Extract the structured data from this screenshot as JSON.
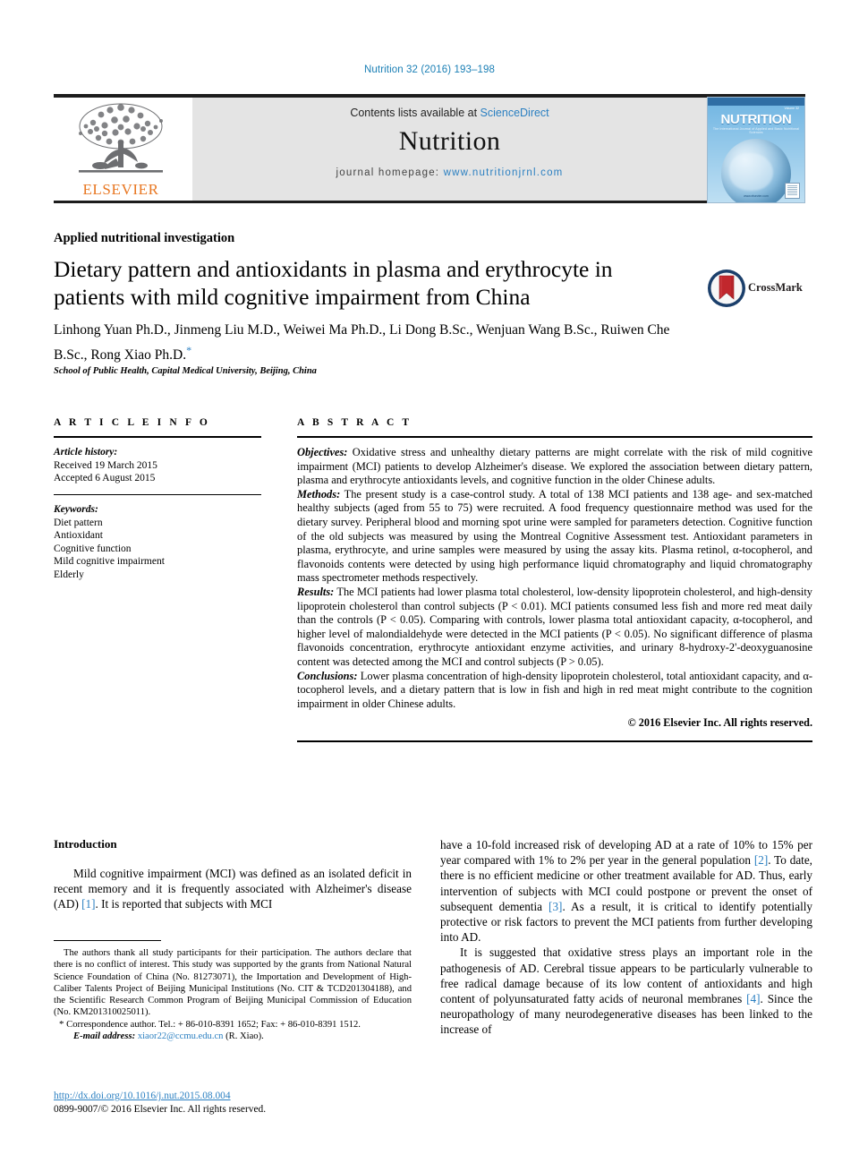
{
  "running_head": "Nutrition 32 (2016) 193–198",
  "masthead": {
    "contents_prefix": "Contents lists available at",
    "contents_link": "ScienceDirect",
    "journal_name": "Nutrition",
    "homepage_prefix": "journal homepage:",
    "homepage_url": "www.nutritionjrnl.com",
    "publisher_name": "ELSEVIER",
    "cover": {
      "title": "NUTRITION",
      "volume": "Volume 32",
      "subtitle": "The International Journal of Applied and Basic Nutritional Sciences",
      "footer": "www.elsevier.com"
    }
  },
  "article": {
    "section_label": "Applied nutritional investigation",
    "title": "Dietary pattern and antioxidants in plasma and erythrocyte in patients with mild cognitive impairment from China",
    "authors": "Linhong Yuan Ph.D., Jinmeng Liu M.D., Weiwei Ma Ph.D., Li Dong B.Sc., Wenjuan Wang B.Sc., Ruiwen Che B.Sc., Rong Xiao Ph.D.",
    "corresponding_marker": "*",
    "affiliation": "School of Public Health, Capital Medical University, Beijing, China",
    "crossmark_label": "CrossMark"
  },
  "article_info": {
    "heading": "A R T I C L E   I N F O",
    "history_label": "Article history:",
    "received": "Received 19 March 2015",
    "accepted": "Accepted 6 August 2015",
    "keywords_label": "Keywords:",
    "keywords": [
      "Diet pattern",
      "Antioxidant",
      "Cognitive function",
      "Mild cognitive impairment",
      "Elderly"
    ]
  },
  "abstract": {
    "heading": "A B S T R A C T",
    "sections": [
      {
        "lead": "Objectives:",
        "text": " Oxidative stress and unhealthy dietary patterns are might correlate with the risk of mild cognitive impairment (MCI) patients to develop Alzheimer's disease. We explored the association between dietary pattern, plasma and erythrocyte antioxidants levels, and cognitive function in the older Chinese adults."
      },
      {
        "lead": "Methods:",
        "text": " The present study is a case-control study. A total of 138 MCI patients and 138 age- and sex-matched healthy subjects (aged from 55 to 75) were recruited. A food frequency questionnaire method was used for the dietary survey. Peripheral blood and morning spot urine were sampled for parameters detection. Cognitive function of the old subjects was measured by using the Montreal Cognitive Assessment test. Antioxidant parameters in plasma, erythrocyte, and urine samples were measured by using the assay kits. Plasma retinol, α-tocopherol, and flavonoids contents were detected by using high performance liquid chromatography and liquid chromatography mass spectrometer methods respectively."
      },
      {
        "lead": "Results:",
        "text": " The MCI patients had lower plasma total cholesterol, low-density lipoprotein cholesterol, and high-density lipoprotein cholesterol than control subjects (P < 0.01). MCI patients consumed less fish and more red meat daily than the controls (P < 0.05). Comparing with controls, lower plasma total antioxidant capacity, α-tocopherol, and higher level of malondialdehyde were detected in the MCI patients (P < 0.05). No significant difference of plasma flavonoids concentration, erythrocyte antioxidant enzyme activities, and urinary 8-hydroxy-2'-deoxyguanosine content was detected among the MCI and control subjects (P > 0.05)."
      },
      {
        "lead": "Conclusions:",
        "text": " Lower plasma concentration of high-density lipoprotein cholesterol, total antioxidant capacity, and α-tocopherol levels, and a dietary pattern that is low in fish and high in red meat might contribute to the cognition impairment in older Chinese adults."
      }
    ],
    "copyright": "© 2016 Elsevier Inc. All rights reserved."
  },
  "body": {
    "intro_heading": "Introduction",
    "left_paragraph_1_a": "Mild cognitive impairment (MCI) was defined as an isolated deficit in recent memory and it is frequently associated with Alzheimer's disease (AD) ",
    "left_paragraph_1_ref": "[1]",
    "left_paragraph_1_b": ". It is reported that subjects with MCI",
    "right_paragraph_1_a": "have a 10-fold increased risk of developing AD at a rate of 10% to 15% per year compared with 1% to 2% per year in the general population ",
    "right_paragraph_1_ref1": "[2]",
    "right_paragraph_1_b": ". To date, there is no efficient medicine or other treatment available for AD. Thus, early intervention of subjects with MCI could postpone or prevent the onset of subsequent dementia ",
    "right_paragraph_1_ref2": "[3]",
    "right_paragraph_1_c": ". As a result, it is critical to identify potentially protective or risk factors to prevent the MCI patients from further developing into AD.",
    "right_paragraph_2_a": "It is suggested that oxidative stress plays an important role in the pathogenesis of AD. Cerebral tissue appears to be particularly vulnerable to free radical damage because of its low content of antioxidants and high content of polyunsaturated fatty acids of neuronal membranes ",
    "right_paragraph_2_ref": "[4]",
    "right_paragraph_2_b": ". Since the neuropathology of many neurodegenerative diseases has been linked to the increase of"
  },
  "footnotes": {
    "acknowledgement": "The authors thank all study participants for their participation. The authors declare that there is no conflict of interest. This study was supported by the grants from National Natural Science Foundation of China (No. 81273071), the Importation and Development of High-Caliber Talents Project of Beijing Municipal Institutions (No. CIT & TCD201304188), and the Scientific Research Common Program of Beijing Municipal Commission of Education (No. KM201310025011).",
    "correspondence_marker": "*",
    "correspondence": "Correspondence author. Tel.: + 86-010-8391 1652; Fax: + 86-010-8391 1512.",
    "email_label": "E-mail address:",
    "email": "xiaor22@ccmu.edu.cn",
    "email_suffix": " (R. Xiao).",
    "doi": "http://dx.doi.org/10.1016/j.nut.2015.08.004",
    "issn_line": "0899-9007/© 2016 Elsevier Inc. All rights reserved."
  },
  "colors": {
    "link_blue": "#2a7fc1",
    "elsevier_orange": "#e87722",
    "crossmark_red": "#c1272d",
    "crossmark_blue": "#1b3f6b"
  }
}
